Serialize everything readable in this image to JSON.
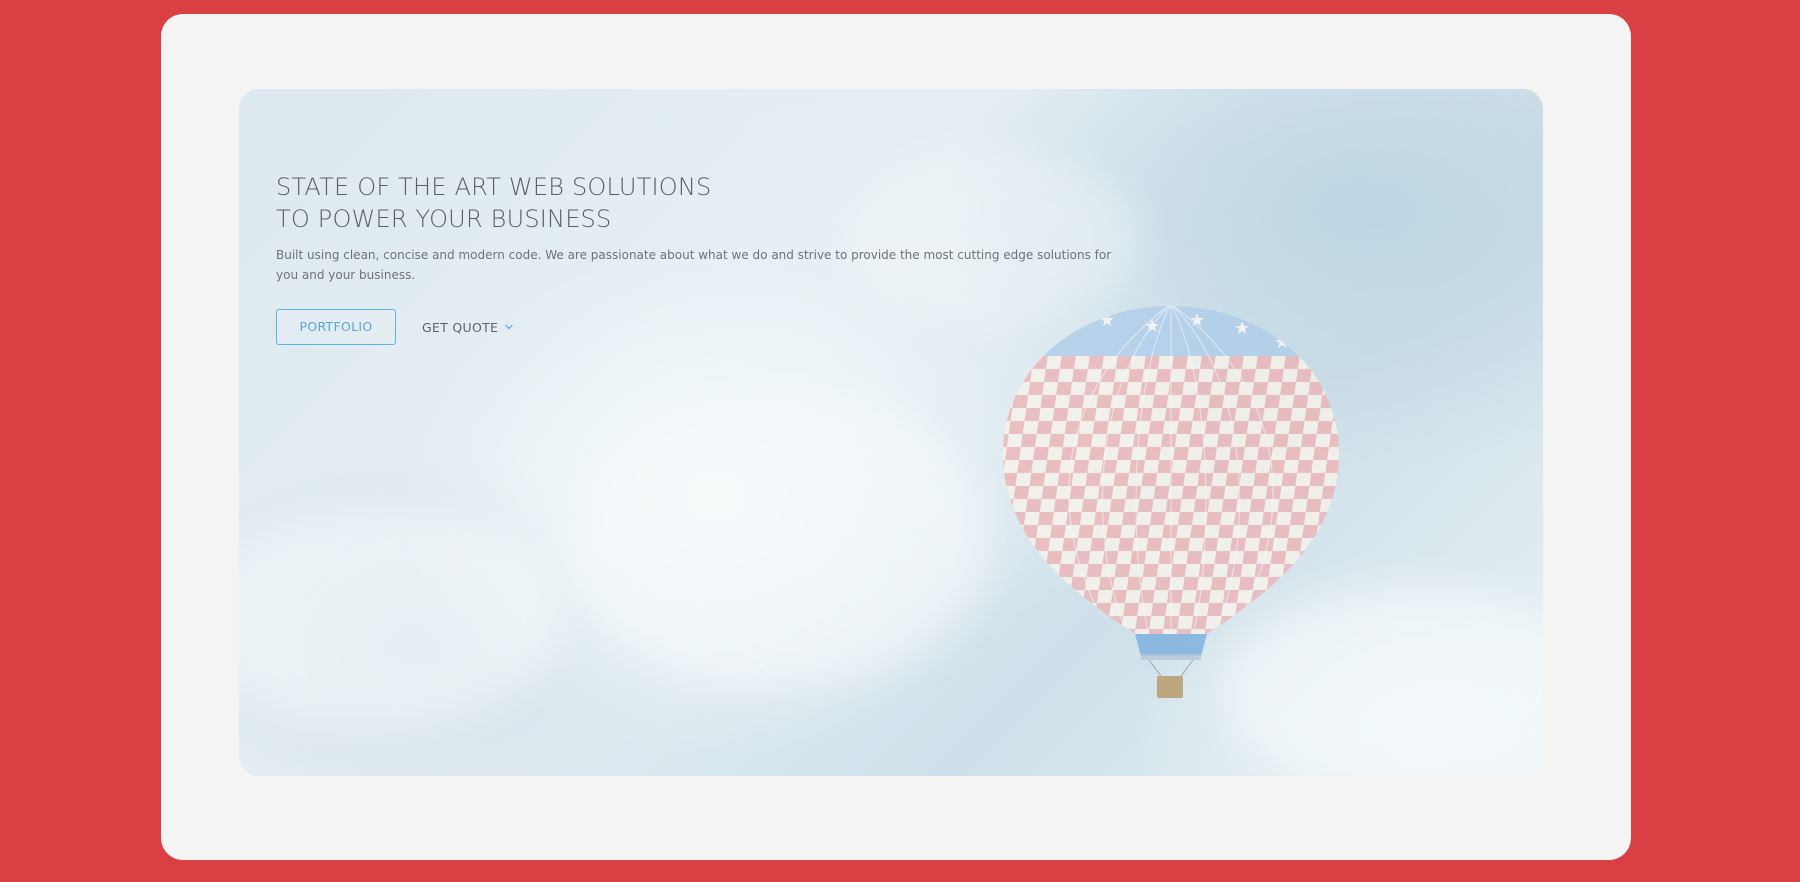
{
  "page": {
    "background_color": "#d84044",
    "frame_color": "#f4f4f4"
  },
  "hero": {
    "headline_line1": "STATE OF THE ART WEB SOLUTIONS",
    "headline_line2": "TO POWER YOUR BUSINESS",
    "subtext": "Built using clean, concise and modern code. We are passionate about what we do and strive to provide the most cutting edge solutions for you and your business.",
    "background_image": "hot-air-balloon-sky",
    "accent_color": "#58b7e8"
  },
  "actions": {
    "portfolio_label": "PORTFOLIO",
    "quote_label": "GET QUOTE",
    "quote_icon": "chevron-down-icon"
  }
}
